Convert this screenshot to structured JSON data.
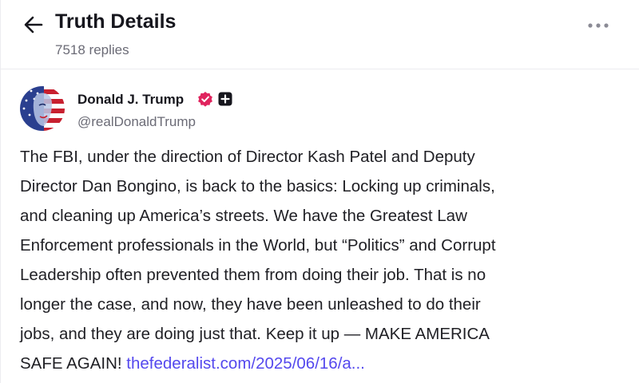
{
  "header": {
    "title": "Truth Details",
    "reply_count": "7518 replies"
  },
  "post": {
    "author_name": "Donald J. Trump",
    "author_handle": "@realDonaldTrump",
    "body_lines": [
      "The FBI, under the direction of Director Kash Patel and Deputy",
      "Director Dan Bongino, is back to the basics: Locking up criminals,",
      "and cleaning up America’s streets. We have the Greatest Law",
      "Enforcement professionals in the World, but “Politics” and Corrupt",
      "Leadership often prevented them from doing their job. That is no",
      "longer the case, and now, they have been unleashed to do their",
      "jobs, and they are doing just that. Keep it up — MAKE AMERICA",
      "SAFE AGAIN! "
    ],
    "link_text": "thefederalist.com/2025/06/16/a..."
  },
  "icons": {
    "back": "arrow-left-icon",
    "more": "more-horizontal-icon",
    "verified": "verified-badge-icon",
    "plus": "plus-badge-icon"
  },
  "colors": {
    "link": "#5448ee",
    "verified": "#e0245e",
    "secondary_text": "#6b6b76"
  }
}
